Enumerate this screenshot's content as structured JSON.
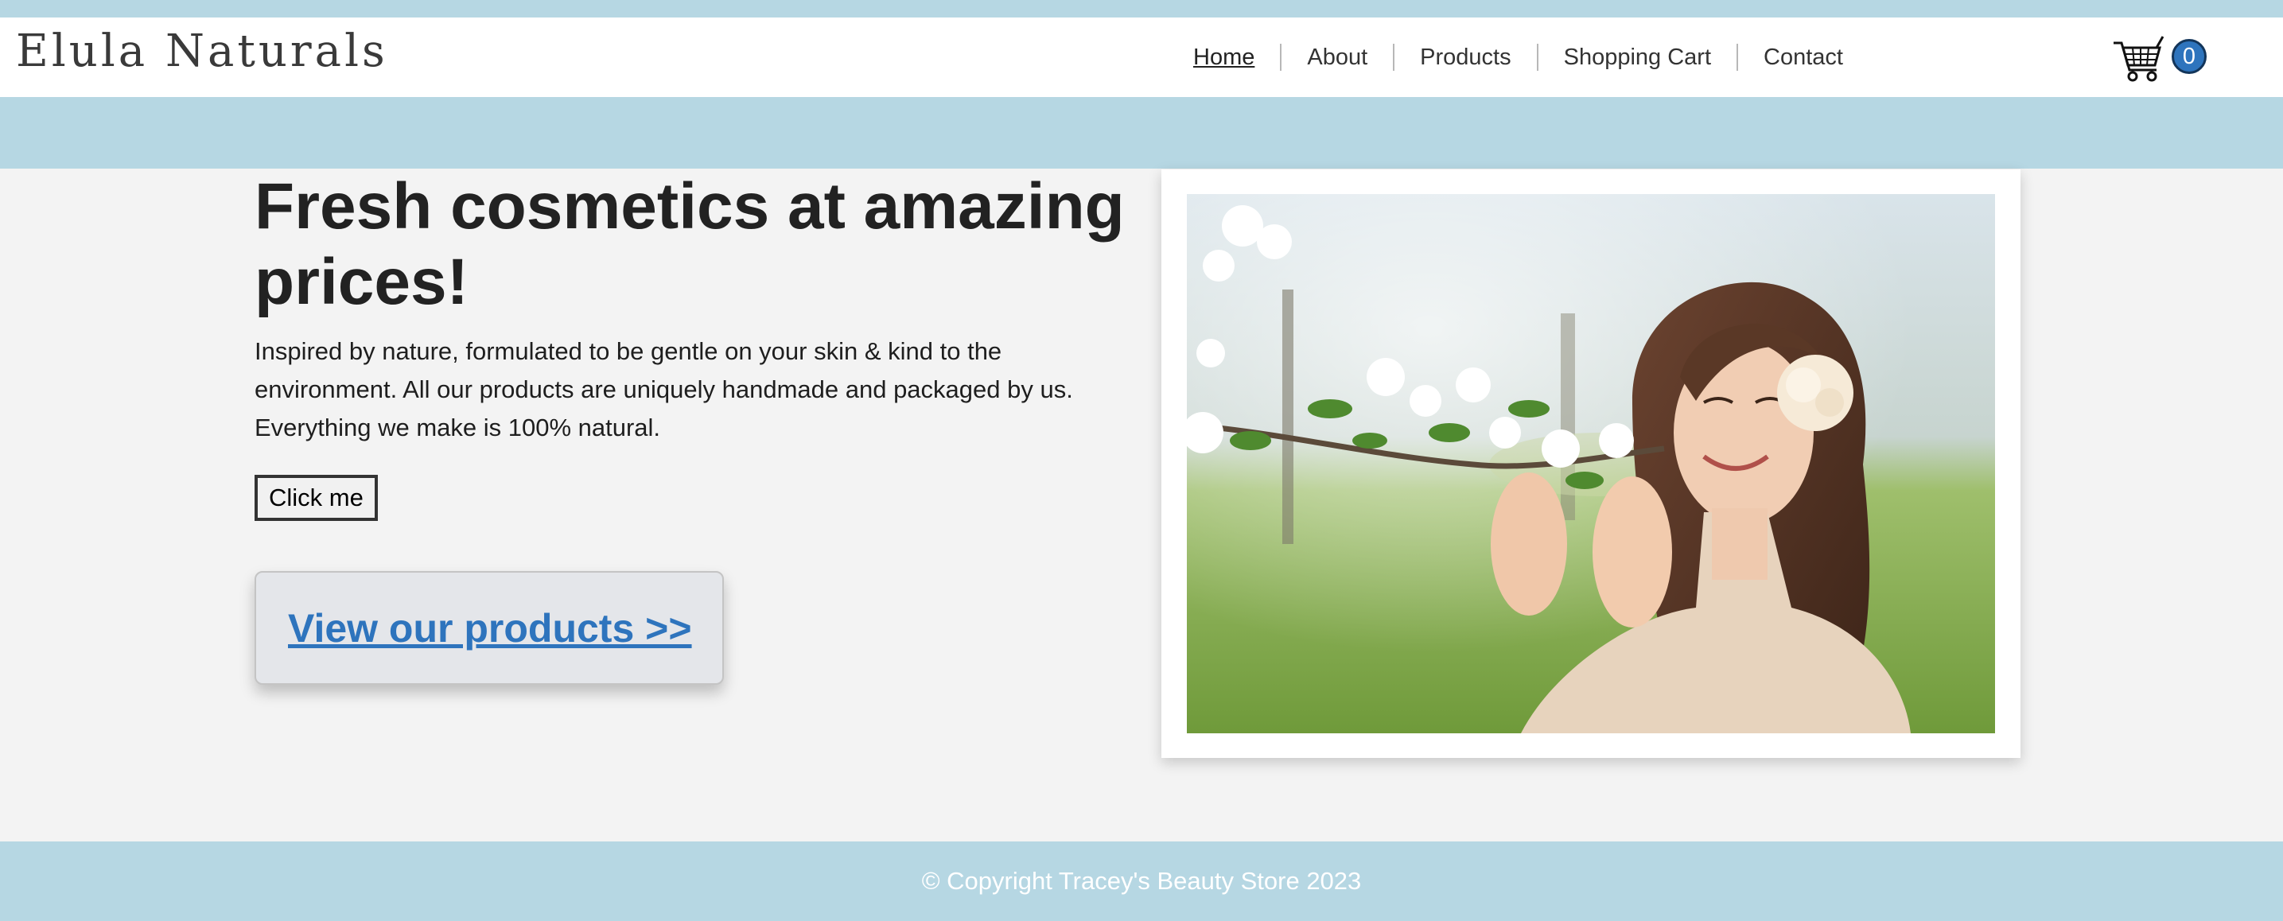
{
  "brand": {
    "logo_text": "Elula Naturals"
  },
  "nav": {
    "items": [
      {
        "label": "Home",
        "active": true
      },
      {
        "label": "About"
      },
      {
        "label": "Products"
      },
      {
        "label": "Shopping Cart"
      },
      {
        "label": "Contact"
      }
    ]
  },
  "cart": {
    "icon": "shopping-cart-icon",
    "count": "0",
    "badge_color": "#2e74bd"
  },
  "hero": {
    "title": "Fresh cosmetics at amazing prices!",
    "description": "Inspired by nature, formulated to be gentle on your skin & kind to the environment. All our products are uniquely handmade and packaged by us. Everything we make is 100% natural.",
    "button_label": "Click me",
    "products_link": "View our products >>",
    "image_subject": "woman smelling blossoming apple tree branch"
  },
  "footer": {
    "copyright": "© Copyright Tracey's Beauty Store 2023"
  },
  "colors": {
    "band": "#b6d7e3",
    "link": "#2e74bd",
    "background": "#f3f3f3"
  }
}
